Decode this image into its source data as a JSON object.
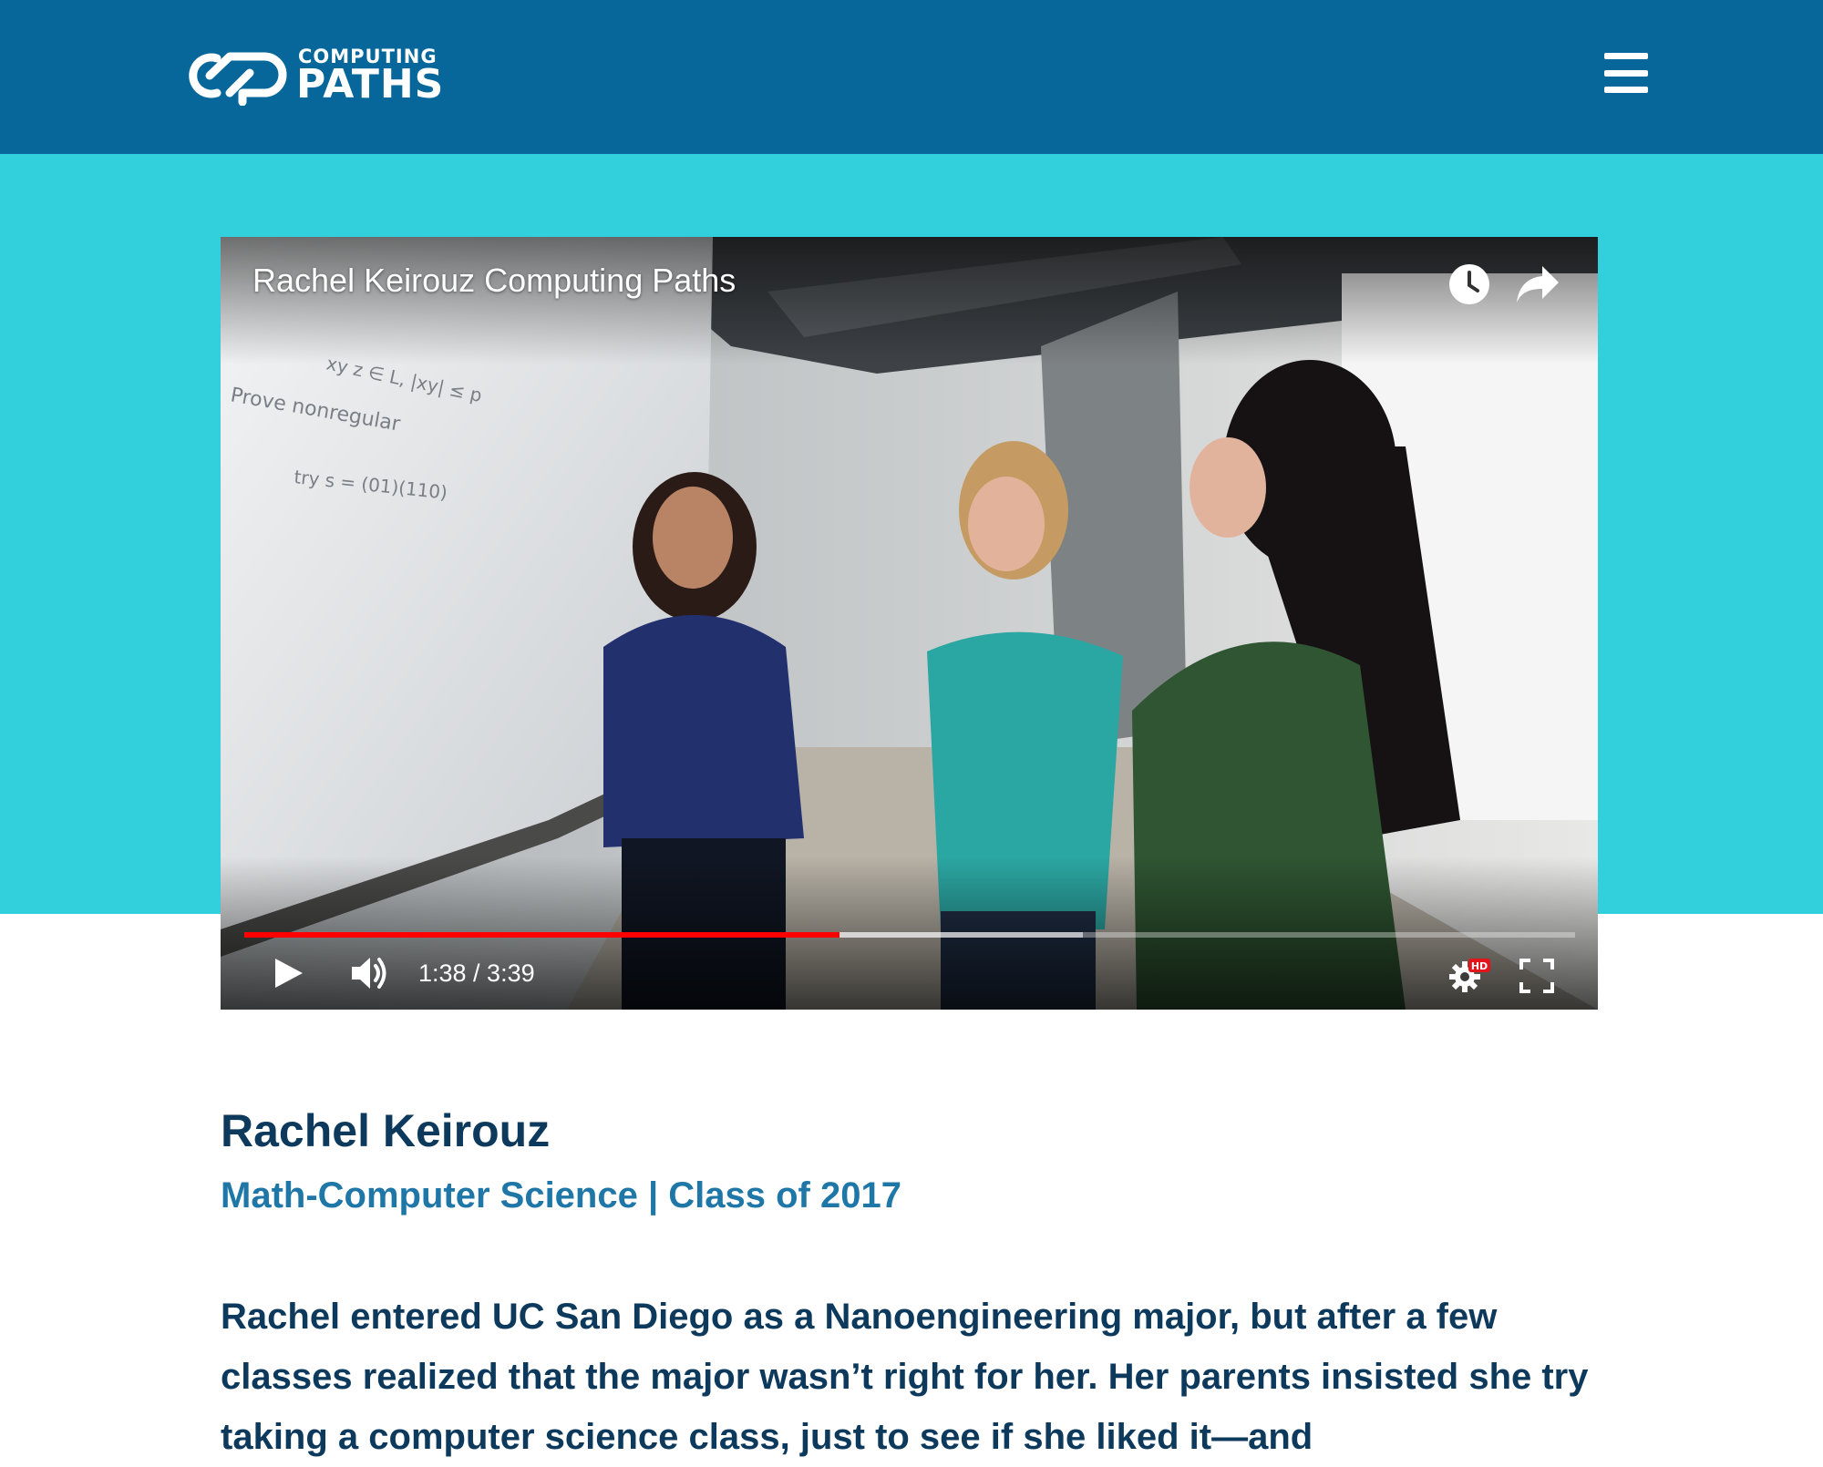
{
  "colors": {
    "header_bg": "#07679a",
    "hero_band": "#32cfdd",
    "heading_text": "#0d3a5c",
    "meta_text": "#1f77a8",
    "progress_played": "#ff0000"
  },
  "header": {
    "logo": {
      "line1": "COMPUTING",
      "line2": "PATHS"
    },
    "menu_icon": "hamburger-menu-icon"
  },
  "video": {
    "title": "Rachel Keirouz Computing Paths",
    "time_display": "1:38 / 3:39",
    "progress_played": 0.447,
    "progress_buffered": 0.63,
    "icons": {
      "watch_later": "clock-icon",
      "share": "share-arrow-icon",
      "play": "play-icon",
      "volume": "volume-icon",
      "settings": "gear-icon",
      "settings_badge": "HD",
      "fullscreen": "fullscreen-icon"
    }
  },
  "profile": {
    "name": "Rachel Keirouz",
    "meta": "Math-Computer Science | Class of 2017",
    "bio": "Rachel entered UC San Diego as a Nanoengineering major, but after a few classes realized that the major wasn’t right for her. Her parents insisted she try taking a computer science class, just to see if she liked it—and"
  }
}
